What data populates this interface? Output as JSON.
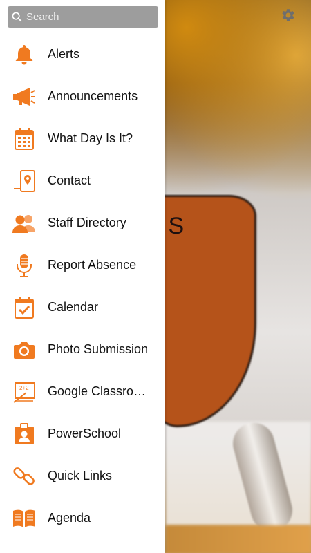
{
  "search": {
    "placeholder": "Search",
    "value": ""
  },
  "accent_color": "#f07a20",
  "settings": {
    "icon": "gear-icon"
  },
  "background": {
    "logo_text": "IS"
  },
  "menu": {
    "items": [
      {
        "label": "Alerts",
        "icon": "bell-icon"
      },
      {
        "label": "Announcements",
        "icon": "megaphone-icon"
      },
      {
        "label": "What Day Is It?",
        "icon": "calendar-grid-icon"
      },
      {
        "label": "Contact",
        "icon": "contact-pin-icon"
      },
      {
        "label": "Staff Directory",
        "icon": "people-icon"
      },
      {
        "label": "Report Absence",
        "icon": "microphone-icon"
      },
      {
        "label": "Calendar",
        "icon": "calendar-check-icon"
      },
      {
        "label": "Photo Submission",
        "icon": "camera-icon"
      },
      {
        "label": "Google Classro…",
        "icon": "classroom-board-icon"
      },
      {
        "label": "PowerSchool",
        "icon": "id-badge-icon"
      },
      {
        "label": "Quick Links",
        "icon": "link-icon"
      },
      {
        "label": "Agenda",
        "icon": "open-book-icon"
      }
    ]
  }
}
